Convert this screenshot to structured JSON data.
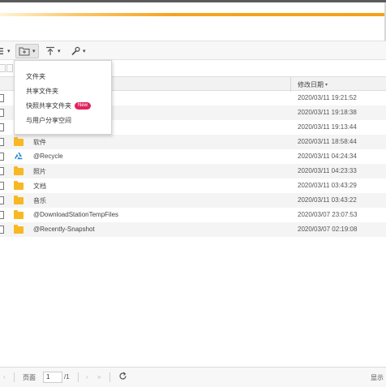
{
  "toolbar": {
    "caret": "▾",
    "buttons": [
      {
        "icon": "list-icon"
      },
      {
        "icon": "new-folder-icon"
      },
      {
        "icon": "upload-icon"
      },
      {
        "icon": "tools-icon"
      }
    ]
  },
  "create_menu": {
    "items": [
      {
        "label": "文件夹"
      },
      {
        "label": "共享文件夹"
      },
      {
        "label": "快照共享文件夹",
        "badge": "New"
      },
      {
        "label": "与用户分享空间"
      }
    ]
  },
  "file_list": {
    "columns": {
      "modified": "修改日期",
      "sort_indicator": "▾"
    },
    "rows": [
      {
        "name": "",
        "date": "2020/03/11 19:21:52",
        "icon": "folder-icon"
      },
      {
        "name": "",
        "date": "2020/03/11 19:18:38",
        "icon": "folder-icon"
      },
      {
        "name": "",
        "date": "2020/03/11 19:13:44",
        "icon": "folder-icon"
      },
      {
        "name": "软件",
        "date": "2020/03/11 18:58:44",
        "icon": "folder-icon"
      },
      {
        "name": "@Recycle",
        "date": "2020/03/11 04:24:34",
        "icon": "recycle-icon"
      },
      {
        "name": "照片",
        "date": "2020/03/11 04:23:33",
        "icon": "folder-icon"
      },
      {
        "name": "文档",
        "date": "2020/03/11 03:43:29",
        "icon": "folder-icon"
      },
      {
        "name": "音乐",
        "date": "2020/03/11 03:43:22",
        "icon": "folder-icon"
      },
      {
        "name": "@DownloadStationTempFiles",
        "date": "2020/03/07 23:07:53",
        "icon": "folder-icon"
      },
      {
        "name": "@Recently-Snapshot",
        "date": "2020/03/07 02:19:08",
        "icon": "folder-icon"
      }
    ]
  },
  "pagination": {
    "page_label": "页面",
    "page_value": "1",
    "total": "/1",
    "prev": "‹",
    "next": "›",
    "last": "»",
    "status_text": "显示"
  }
}
